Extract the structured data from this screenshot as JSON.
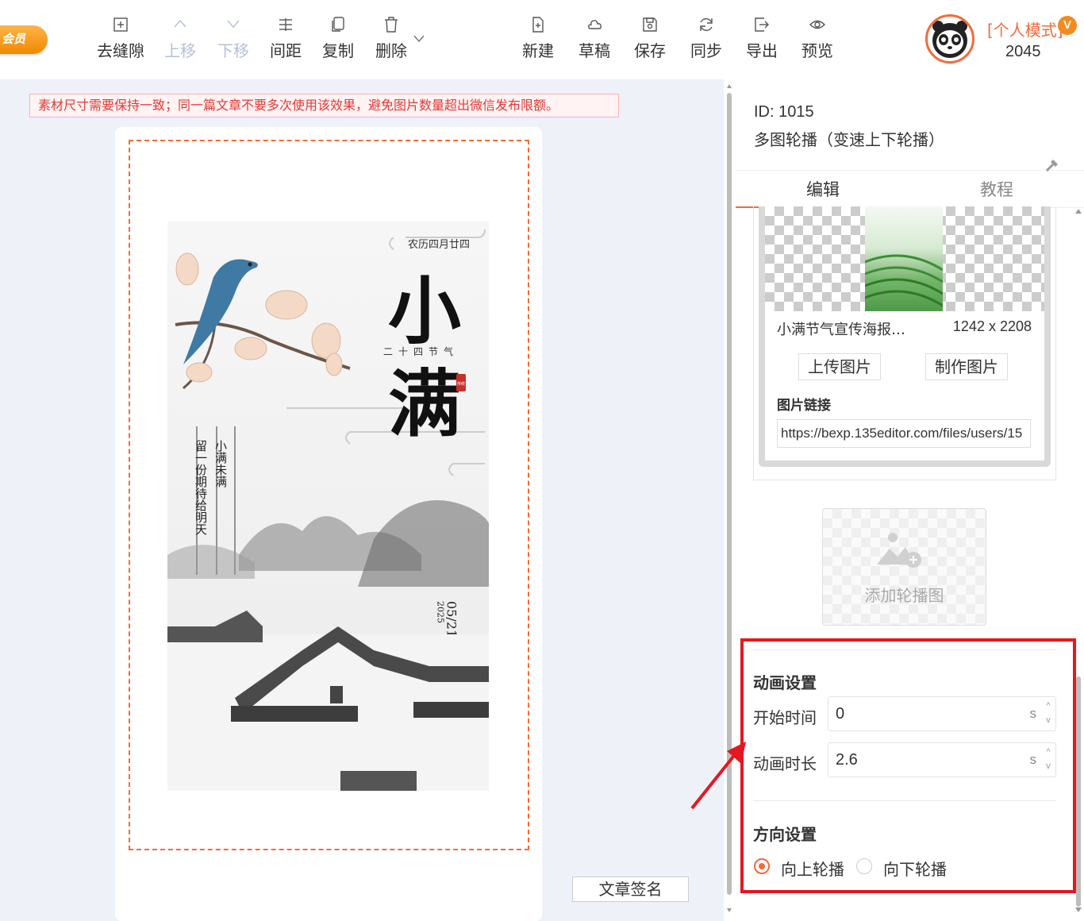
{
  "toolbar": {
    "vip_badge": "会员",
    "buttons": [
      {
        "label": "去缝隙",
        "icon": "gap-icon",
        "disabled": false
      },
      {
        "label": "上移",
        "icon": "arrow-up-icon",
        "disabled": true
      },
      {
        "label": "下移",
        "icon": "arrow-down-icon",
        "disabled": true
      },
      {
        "label": "间距",
        "icon": "spacing-icon",
        "disabled": false
      },
      {
        "label": "复制",
        "icon": "copy-icon",
        "disabled": false
      },
      {
        "label": "删除",
        "icon": "trash-icon",
        "disabled": false
      },
      {
        "label": "新建",
        "icon": "new-file-icon",
        "disabled": false
      },
      {
        "label": "草稿",
        "icon": "cloud-icon",
        "disabled": false
      },
      {
        "label": "保存",
        "icon": "save-icon",
        "disabled": false
      },
      {
        "label": "同步",
        "icon": "sync-icon",
        "disabled": false
      },
      {
        "label": "导出",
        "icon": "export-icon",
        "disabled": false
      },
      {
        "label": "预览",
        "icon": "eye-icon",
        "disabled": false
      }
    ],
    "mode_label": "[个人模式]",
    "vip_letter": "V",
    "points": "2045"
  },
  "canvas": {
    "warning": "素材尺寸需要保持一致；同一篇文章不要多次使用该效果，避免图片数量超出微信发布限额。",
    "poster": {
      "lunar_date": "农历四月廿四",
      "title_1": "小",
      "title_2": "满",
      "subtitle": "二十四节气",
      "seal": "传统",
      "poem_right": "小满未满",
      "poem_left": "留一份期待给明天",
      "date": "05/21",
      "year": "2025"
    },
    "sign_button": "文章签名"
  },
  "panel": {
    "id_text": "ID: 1015",
    "name": "多图轮播（变速上下轮播）",
    "tabs": [
      {
        "label": "编辑",
        "active": true
      },
      {
        "label": "教程",
        "active": false
      }
    ],
    "image": {
      "filename": "小满节气宣传海报…",
      "size": "1242 x 2208",
      "upload_label": "上传图片",
      "make_label": "制作图片",
      "link_label": "图片链接",
      "link_value": "https://bexp.135editor.com/files/users/15"
    },
    "add_carousel_label": "添加轮播图",
    "animation": {
      "title": "动画设置",
      "start_label": "开始时间",
      "start_value": "0",
      "duration_label": "动画时长",
      "duration_value": "2.6",
      "unit": "s"
    },
    "direction": {
      "title": "方向设置",
      "options": [
        {
          "label": "向上轮播",
          "selected": true
        },
        {
          "label": "向下轮播",
          "selected": false
        }
      ]
    }
  },
  "colors": {
    "accent": "#f36b3b",
    "highlight_box": "#e5171f",
    "warning_text": "#e53935",
    "canvas_bg": "#eef1f8"
  }
}
